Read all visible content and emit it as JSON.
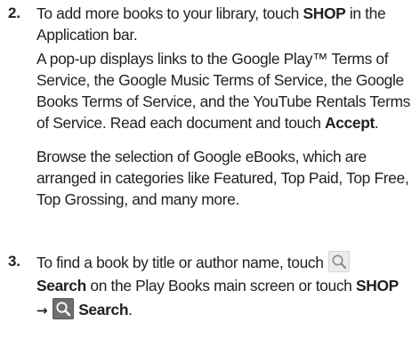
{
  "steps": [
    {
      "number": "2.",
      "intro_a": "To add more books to your library, touch ",
      "intro_shop": "SHOP",
      "intro_b": " in the Application bar.",
      "popup_text": "A pop-up displays links to the Google Play™ Terms of Service, the Google Music Terms of Service, the Google Books Terms of Service, and the YouTube Rentals Terms of Service. Read each document and touch ",
      "popup_accept": "Accept",
      "popup_end": ".",
      "browse_text": "Browse the selection of Google eBooks, which are arranged in categories like Featured, Top Paid, Top Free, Top Grossing, and many more."
    },
    {
      "number": "3.",
      "find_a": "To find a book by title or author name, touch ",
      "search_label": "Search",
      "find_b": " on the Play Books main screen or touch ",
      "shop_label": "SHOP",
      "arrow": "→",
      "search_label_2": "Search",
      "end": "."
    }
  ],
  "icons": {
    "search_light": "search-icon",
    "search_dark": "search-icon-dark"
  },
  "colors": {
    "text": "#231f20",
    "icon_light_bg": "#ececec",
    "icon_dark_bg": "#6e6e6e"
  }
}
